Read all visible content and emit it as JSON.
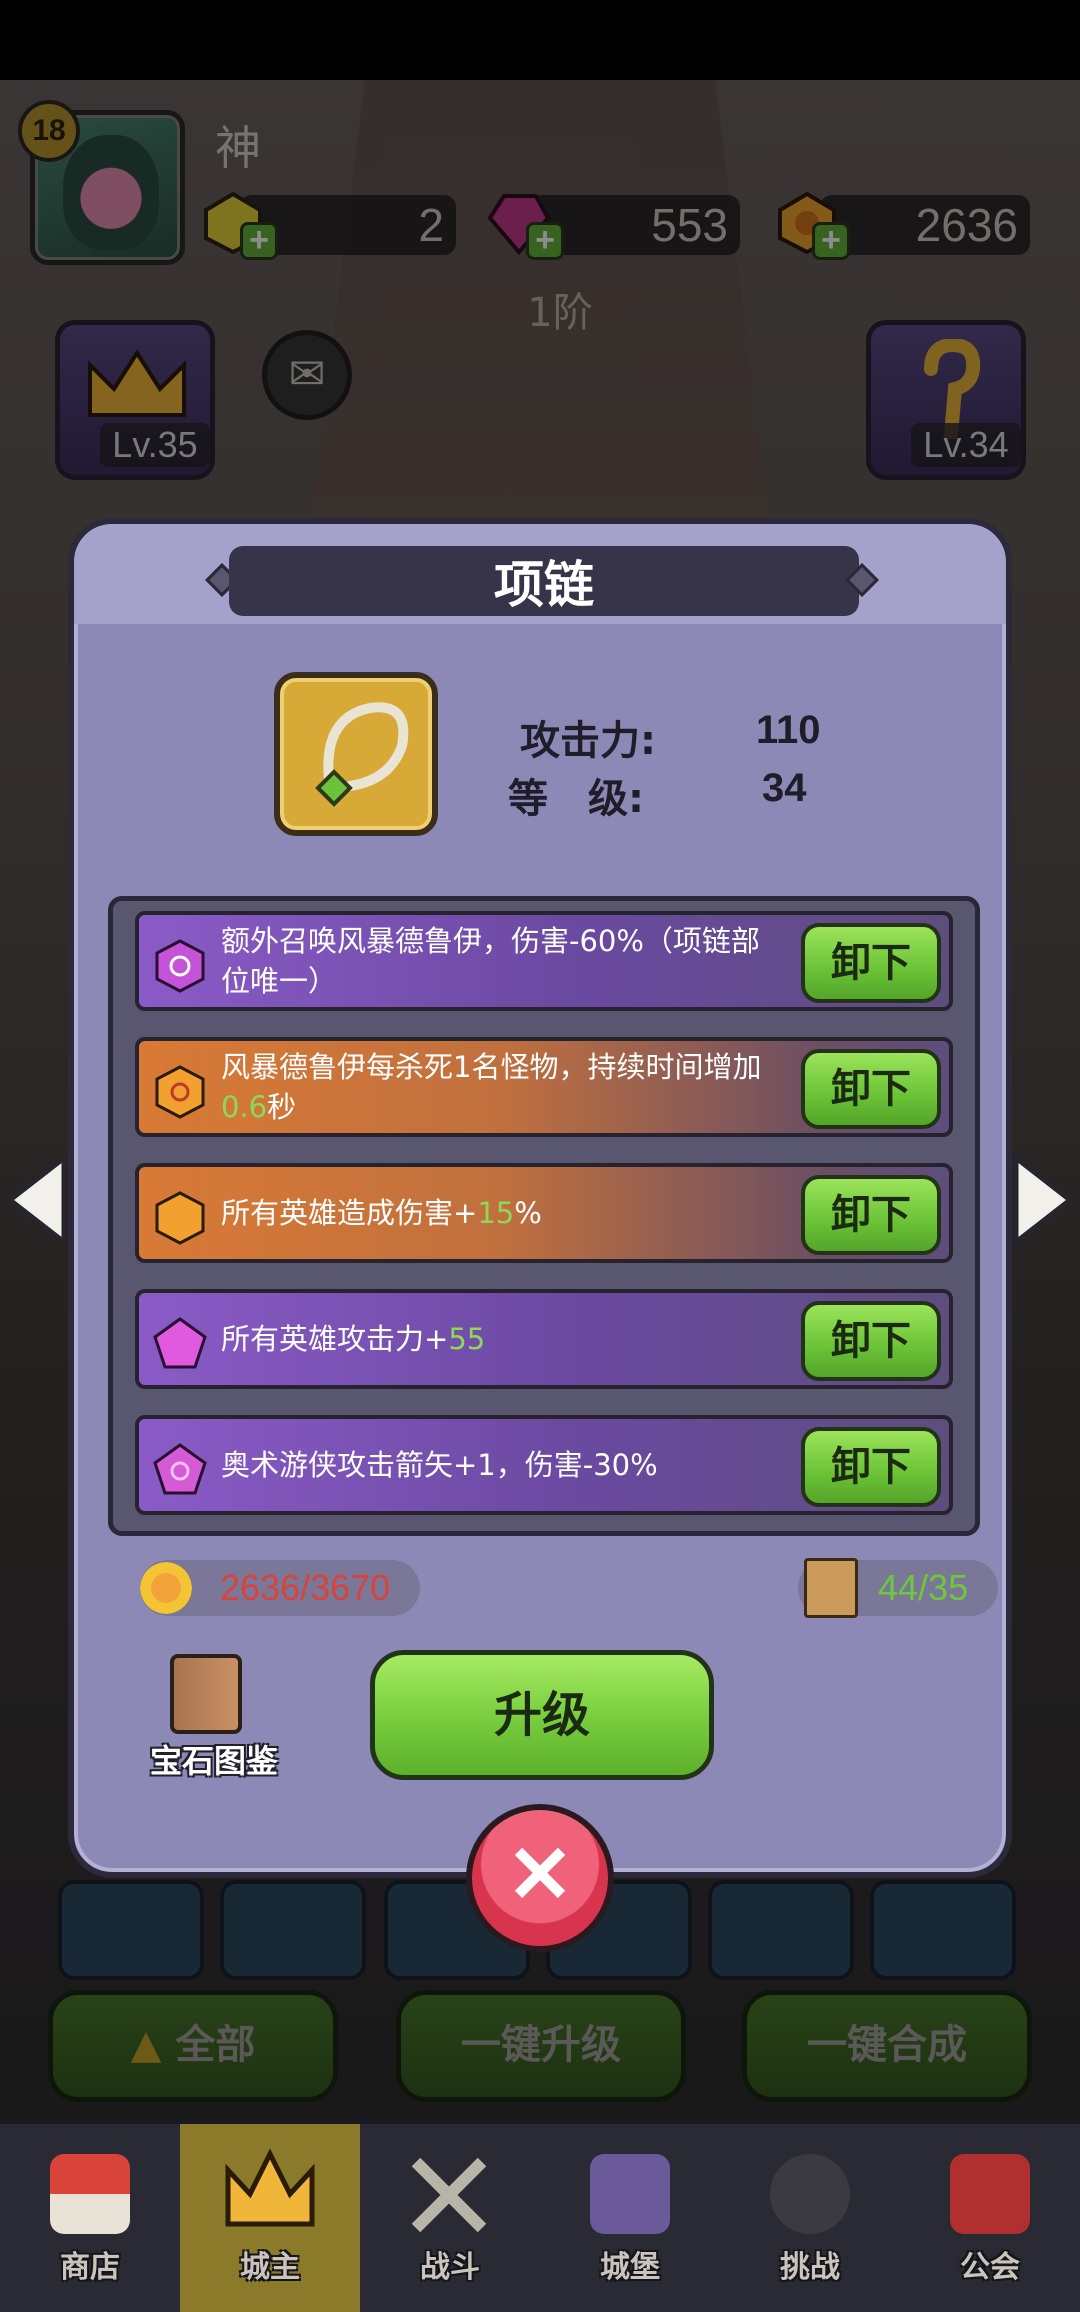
{
  "player": {
    "level": "18",
    "name": "神"
  },
  "resources": [
    {
      "name": "yellow-gem",
      "value": "2"
    },
    {
      "name": "purple-crystal",
      "value": "553"
    },
    {
      "name": "gold-coin",
      "value": "2636"
    }
  ],
  "tier": "1阶",
  "side_cards": {
    "left_level": "Lv.35",
    "right_level": "Lv.34"
  },
  "modal": {
    "title": "项链",
    "stats": [
      {
        "label": "攻击力:",
        "value": "110"
      },
      {
        "label": "等　级:",
        "value": "34"
      }
    ],
    "gems": [
      {
        "color": "purple",
        "text": "额外召唤风暴德鲁伊，伤害-60%（项链部位唯一）",
        "button": "卸下"
      },
      {
        "color": "orange",
        "text_before": "风暴德鲁伊每杀死1名怪物，持续时间增加",
        "highlight": "0.6",
        "text_after": "秒",
        "button": "卸下"
      },
      {
        "color": "orange",
        "text_before": "所有英雄造成伤害+",
        "highlight": "15",
        "text_after": "%",
        "button": "卸下"
      },
      {
        "color": "purple",
        "text_before": "所有英雄攻击力+",
        "highlight": "55",
        "text_after": "",
        "button": "卸下"
      },
      {
        "color": "purple",
        "text": "奥术游侠攻击箭矢+1，伤害-30%",
        "button": "卸下"
      }
    ],
    "cost": {
      "coins": "2636/3670",
      "coins_color": "#d9433a",
      "scrolls": "44/35",
      "scrolls_color": "#6ec83c"
    },
    "codex_label": "宝石图鉴",
    "upgrade_label": "升级"
  },
  "actions": [
    "全部",
    "一键升级",
    "一键合成"
  ],
  "nav": [
    {
      "label": "商店",
      "icon": "shop-icon"
    },
    {
      "label": "城主",
      "icon": "crown-icon",
      "active": true
    },
    {
      "label": "战斗",
      "icon": "swords-icon"
    },
    {
      "label": "城堡",
      "icon": "castle-icon"
    },
    {
      "label": "挑战",
      "icon": "demon-icon"
    },
    {
      "label": "公会",
      "icon": "banner-icon"
    }
  ]
}
